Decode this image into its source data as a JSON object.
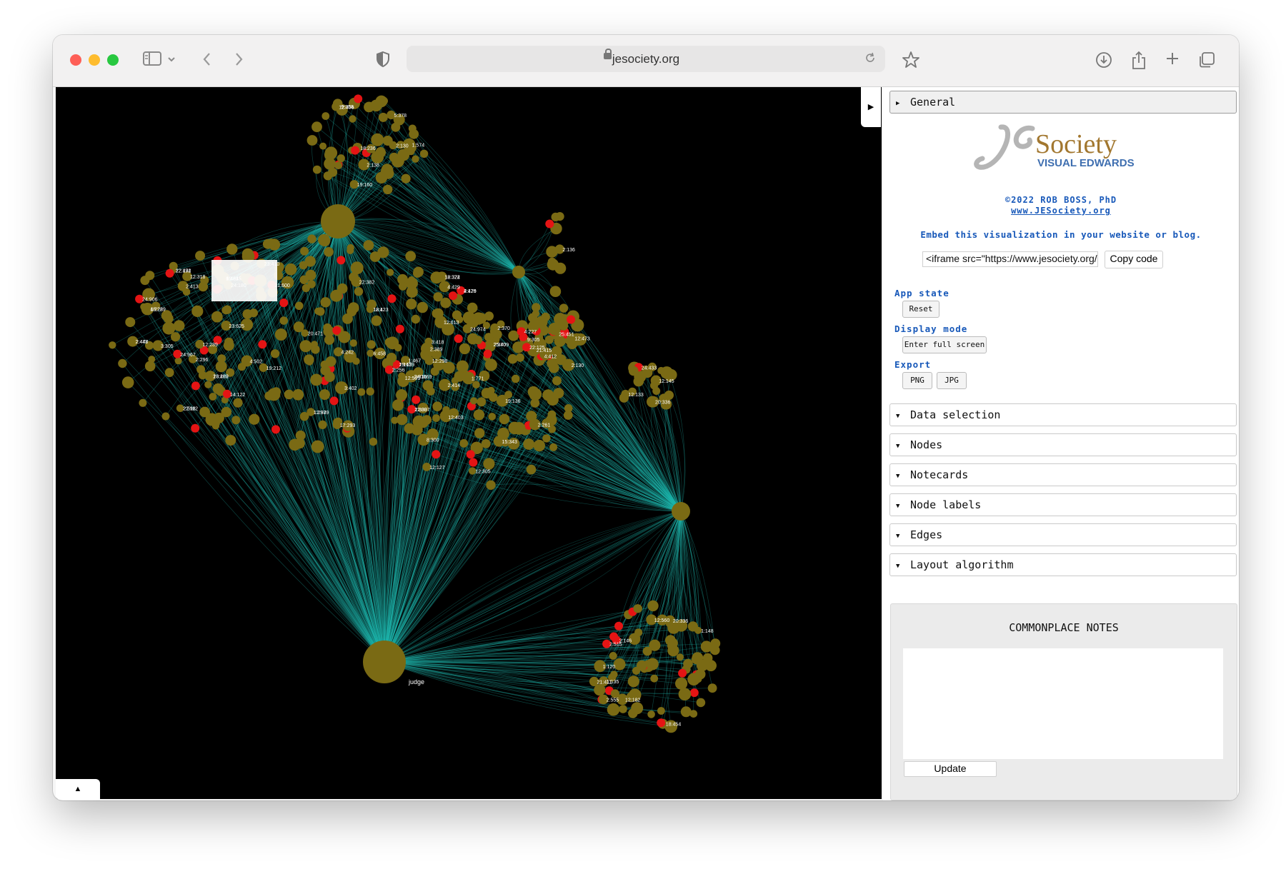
{
  "browser": {
    "url": "jesociety.org"
  },
  "graph": {
    "label_judge": "judge",
    "node_labels": [
      "25:709",
      "22:112",
      "4:179",
      "19:159",
      "23:402",
      "2:448",
      "24:1169",
      "12:374",
      "12:4",
      "4:222",
      "2:300",
      "12:339",
      "22:192",
      "19:645",
      "24:180",
      "6:458",
      "3:418",
      "17:293",
      "4:502",
      "3:305",
      "19:212",
      "12:318",
      "4:429",
      "3:402",
      "12:613",
      "2:413",
      "22:382",
      "2:256",
      "4:242",
      "23:410",
      "14:122",
      "20:471",
      "2:296",
      "21:600",
      "24:906",
      "12:289",
      "23:625",
      "24:967",
      "12:298",
      "19:136",
      "1:467",
      "2:414",
      "15:343",
      "2:261",
      "8:300",
      "2:389",
      "9:305",
      "2:130",
      "1:771",
      "12:403",
      "12:305",
      "24:974",
      "12:127",
      "2:370",
      "12:531",
      "18:236",
      "19:160",
      "2:130",
      "2:138",
      "9:353",
      "5:378",
      "1:574",
      "12:406",
      "25:451",
      "4:227",
      "12:473",
      "4:412",
      "21:415",
      "22:125",
      "12:145",
      "12:133",
      "24:433",
      "20:336",
      "21:411",
      "18:454",
      "1:148",
      "2:146",
      "2:555",
      "2:515",
      "12:560",
      "12:182",
      "20:336",
      "1:120",
      "1:135",
      "2:136",
      "2:340",
      "2:598",
      "2:426",
      "2:162",
      "18:289",
      "2:477",
      "2:336",
      "18:322",
      "18:123",
      "18:289",
      "12:337",
      "1:297",
      "12:474",
      "6:421"
    ]
  },
  "panel": {
    "general_label": "General",
    "logo": {
      "brand": "Society",
      "subtitle": "VISUAL EDWARDS"
    },
    "copyright": "©2022 ROB BOSS, PhD",
    "site_link": "www.JESociety.org",
    "embed_text": "Embed this visualization in your website or blog.",
    "embed_code": "<iframe src=\"https://www.jesociety.org/i",
    "copy_code_label": "Copy code",
    "app_state_label": "App state",
    "reset_label": "Reset",
    "display_mode_label": "Display mode",
    "fullscreen_label": "Enter full screen",
    "export_label": "Export",
    "png_label": "PNG",
    "jpg_label": "JPG",
    "sections": [
      {
        "label": "Data selection"
      },
      {
        "label": "Nodes"
      },
      {
        "label": "Notecards"
      },
      {
        "label": "Node labels"
      },
      {
        "label": "Edges"
      },
      {
        "label": "Layout algorithm"
      }
    ],
    "notes_title": "COMMONPLACE NOTES",
    "update_label": "Update"
  },
  "colors": {
    "edge": "#1fb8b0",
    "node": "#7a6a14",
    "highlight_node": "#e41414",
    "panel_link": "#1758b9"
  }
}
